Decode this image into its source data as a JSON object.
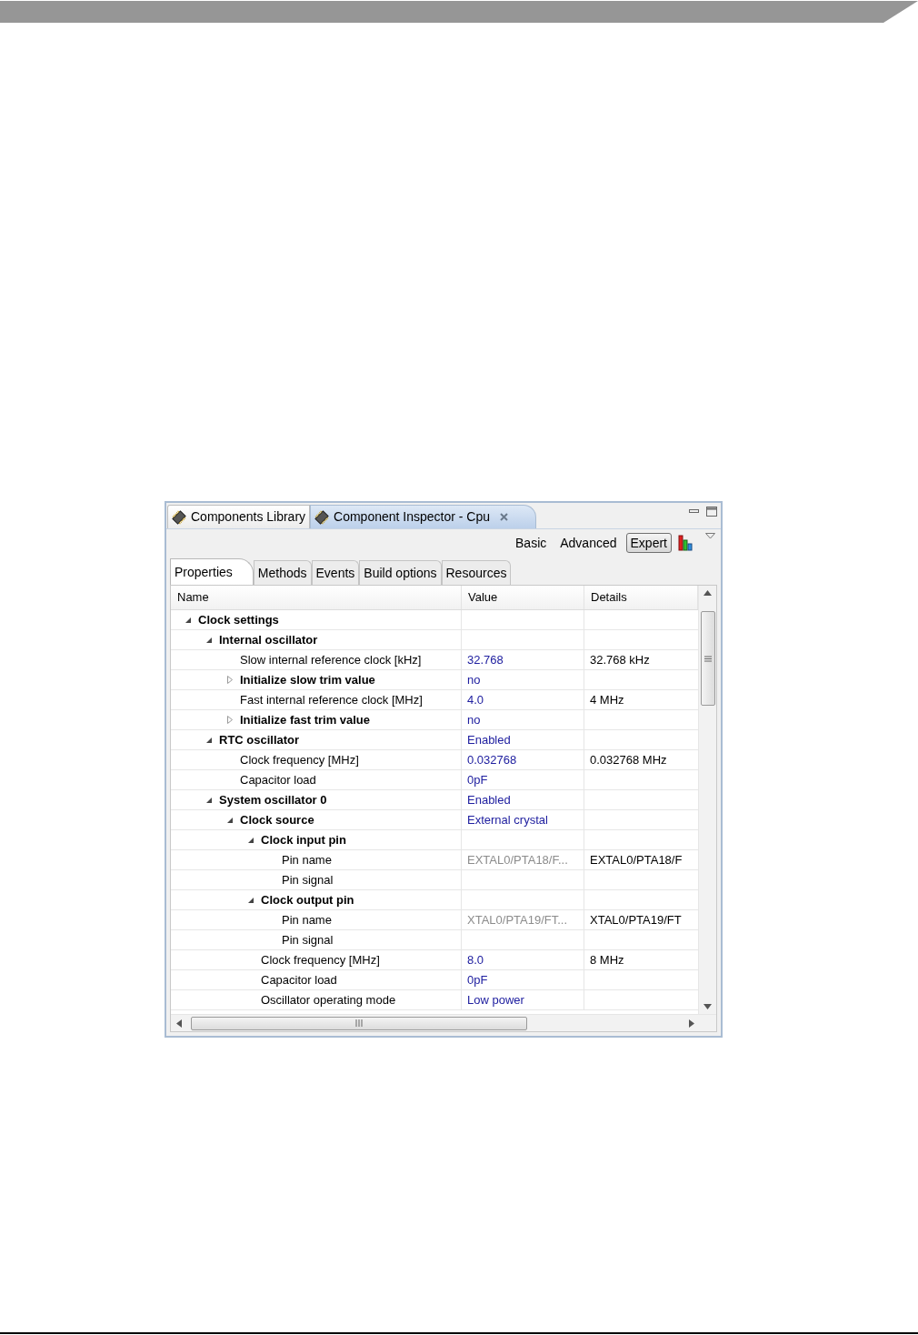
{
  "view_tabs": [
    {
      "label": "Components Library",
      "selected": false,
      "closable": false
    },
    {
      "label": "Component Inspector - Cpu",
      "selected": true,
      "closable": true
    }
  ],
  "modes": [
    {
      "label": "Basic",
      "selected": false
    },
    {
      "label": "Advanced",
      "selected": false
    },
    {
      "label": "Expert",
      "selected": true
    }
  ],
  "tabs": [
    {
      "label": "Properties",
      "selected": true
    },
    {
      "label": "Methods",
      "selected": false
    },
    {
      "label": "Events",
      "selected": false
    },
    {
      "label": "Build options",
      "selected": false
    },
    {
      "label": "Resources",
      "selected": false
    }
  ],
  "table": {
    "columns": [
      "Name",
      "Value",
      "Details"
    ],
    "rows": [
      {
        "name": "Clock settings",
        "kind": "group",
        "expanded": true,
        "children": [
          {
            "name": "Internal oscillator",
            "kind": "group",
            "expanded": true,
            "children": [
              {
                "name": "Slow internal reference clock [kHz]",
                "kind": "property",
                "value": "32.768",
                "read_only": false,
                "details": "32.768 kHz"
              },
              {
                "name": "Initialize slow trim value",
                "kind": "group",
                "expanded": false,
                "value": "no",
                "read_only": false
              },
              {
                "name": "Fast internal reference clock [MHz]",
                "kind": "property",
                "value": "4.0",
                "read_only": false,
                "details": "4 MHz"
              },
              {
                "name": "Initialize fast trim value",
                "kind": "group",
                "expanded": false,
                "value": "no",
                "read_only": false
              }
            ]
          },
          {
            "name": "RTC oscillator",
            "kind": "group",
            "expanded": true,
            "value": "Enabled",
            "read_only": false,
            "children": [
              {
                "name": "Clock frequency [MHz]",
                "kind": "property",
                "value": "0.032768",
                "read_only": false,
                "details": "0.032768 MHz"
              },
              {
                "name": "Capacitor load",
                "kind": "property",
                "value": "0pF",
                "read_only": false
              }
            ]
          },
          {
            "name": "System oscillator 0",
            "kind": "group",
            "expanded": true,
            "value": "Enabled",
            "read_only": false,
            "children": [
              {
                "name": "Clock source",
                "kind": "group",
                "expanded": true,
                "value": "External crystal",
                "read_only": false,
                "children": [
                  {
                    "name": "Clock input pin",
                    "kind": "group",
                    "expanded": true,
                    "children": [
                      {
                        "name": "Pin name",
                        "kind": "property",
                        "value": "EXTAL0/PTA18/F...",
                        "read_only": true,
                        "details": "EXTAL0/PTA18/F"
                      },
                      {
                        "name": "Pin signal",
                        "kind": "property"
                      }
                    ]
                  },
                  {
                    "name": "Clock output pin",
                    "kind": "group",
                    "expanded": true,
                    "children": [
                      {
                        "name": "Pin name",
                        "kind": "property",
                        "value": "XTAL0/PTA19/FT...",
                        "read_only": true,
                        "details": "XTAL0/PTA19/FT"
                      },
                      {
                        "name": "Pin signal",
                        "kind": "property"
                      }
                    ]
                  },
                  {
                    "name": "Clock frequency [MHz]",
                    "kind": "property",
                    "value": "8.0",
                    "read_only": false,
                    "details": "8 MHz"
                  },
                  {
                    "name": "Capacitor load",
                    "kind": "property",
                    "value": "0pF",
                    "read_only": false
                  },
                  {
                    "name": "Oscillator operating mode",
                    "kind": "property",
                    "value": "Low power",
                    "read_only": false
                  }
                ]
              }
            ]
          }
        ]
      }
    ]
  }
}
